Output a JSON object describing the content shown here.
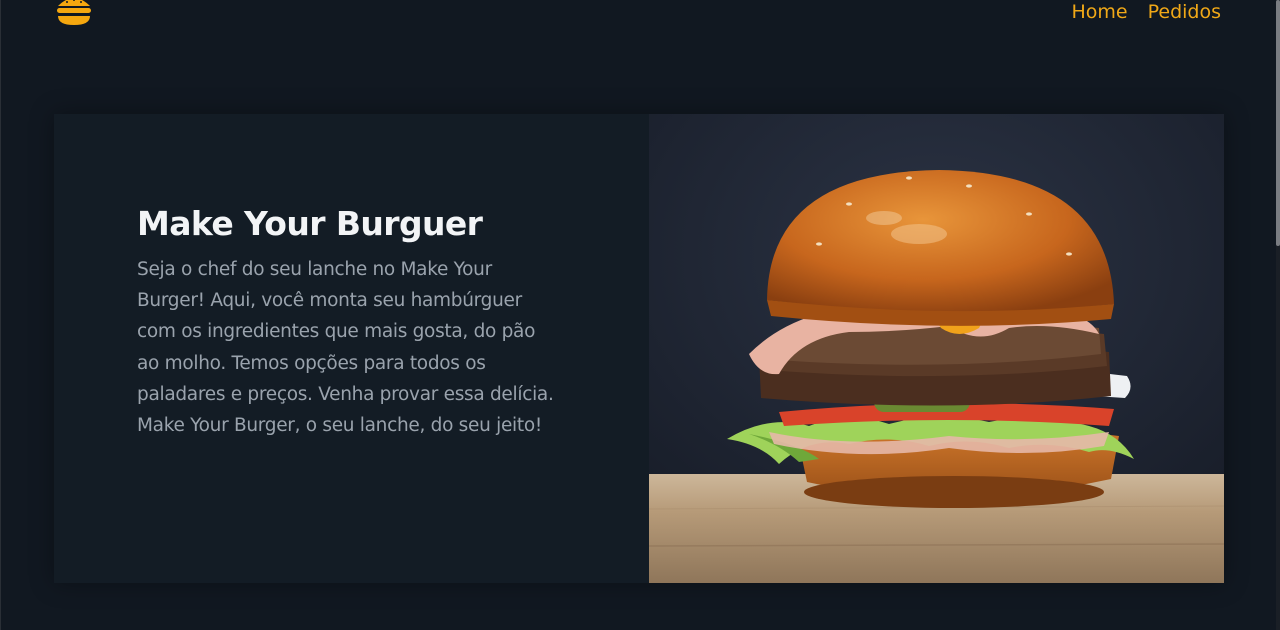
{
  "navbar": {
    "logo_icon": "burger-icon",
    "links": [
      {
        "label": "Home"
      },
      {
        "label": "Pedidos"
      }
    ],
    "link_color": "#f0a817"
  },
  "hero": {
    "title": "Make Your Burguer",
    "description": "Seja o chef do seu lanche no Make Your Burger! Aqui, você monta seu hambúrguer com os ingredientes que mais gosta, do pão ao molho. Temos opções para todos os paladares e preços. Venha provar essa delícia. Make Your Burger, o seu lanche, do seu jeito!",
    "image_icon": "burger-photo"
  },
  "colors": {
    "background": "#111821",
    "card": "#131c25",
    "accent": "#f0a817",
    "title": "#f2f4f6",
    "text": "#9aa3ad"
  }
}
